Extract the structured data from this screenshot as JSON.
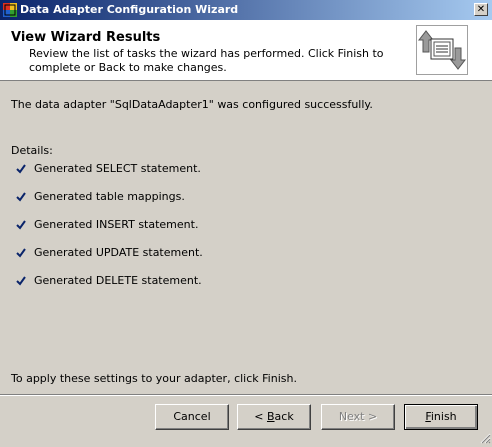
{
  "window": {
    "title": "Data Adapter Configuration Wizard"
  },
  "header": {
    "title": "View Wizard Results",
    "description": "Review the list of tasks the wizard has performed. Click Finish to complete or Back to make changes."
  },
  "main": {
    "status": "The data adapter \"SqlDataAdapter1\" was configured successfully.",
    "details_label": "Details:",
    "details": [
      "Generated SELECT statement.",
      "Generated table mappings.",
      "Generated INSERT statement.",
      "Generated UPDATE statement.",
      "Generated DELETE statement."
    ],
    "footer_note": "To apply these settings to your adapter, click Finish."
  },
  "buttons": {
    "cancel": "Cancel",
    "back_pre": "< ",
    "back_key": "B",
    "back_post": "ack",
    "next": "Next >",
    "finish_key": "F",
    "finish_post": "inish"
  },
  "icons": {
    "app": "wizard-app-icon",
    "close": "close-icon",
    "header": "data-exchange-icon",
    "check": "checkmark-icon",
    "grip": "resize-grip-icon"
  },
  "colors": {
    "titlebar_start": "#0a246a",
    "titlebar_end": "#a6caf0",
    "check": "#0a246a"
  }
}
